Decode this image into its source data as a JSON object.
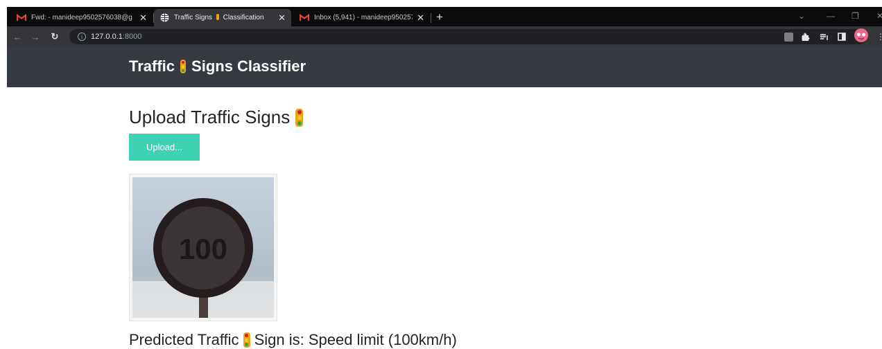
{
  "browser": {
    "tabs": [
      {
        "title": "Fwd: - manideep9502576038@g",
        "icon": "gmail-icon"
      },
      {
        "title_before": "Traffic Signs",
        "title_after": "Classification",
        "icon": "globe-icon",
        "active": true
      },
      {
        "title": "Inbox (5,941) - manideep950257",
        "icon": "gmail-icon"
      }
    ],
    "url": {
      "host": "127.0.0.1",
      "port": ":8000"
    },
    "accent": "#35363a"
  },
  "navbar": {
    "brand_before": "Traffic",
    "brand_after": "Signs Classifier",
    "background": "#343a40"
  },
  "main": {
    "heading": "Upload Traffic Signs",
    "upload_label": "Upload...",
    "upload_color": "#3fd1b3",
    "image_sign_text": "100",
    "result_before": "Predicted Traffic",
    "result_after": "Sign is: Speed limit (100km/h)"
  }
}
